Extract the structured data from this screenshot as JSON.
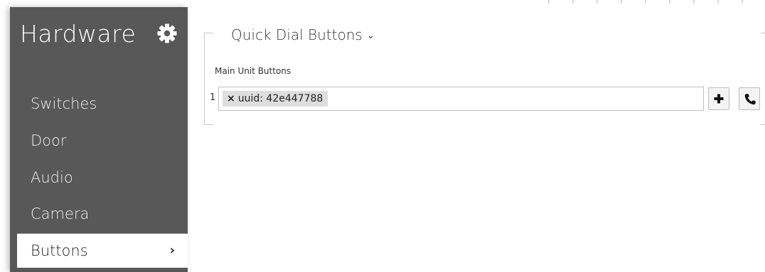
{
  "sidebar": {
    "title": "Hardware",
    "items": [
      {
        "label": "Switches"
      },
      {
        "label": "Door"
      },
      {
        "label": "Audio"
      },
      {
        "label": "Camera"
      },
      {
        "label": "Buttons",
        "chevron": "›"
      }
    ],
    "active_index": 4,
    "background": "#585858"
  },
  "main": {
    "section_title": "Quick Dial Buttons",
    "section_caret": "⌄",
    "field_label": "Main Unit Buttons",
    "rows": [
      {
        "index": "1",
        "tags": [
          {
            "remove": "×",
            "label": "uuid: 42e447788"
          }
        ]
      }
    ],
    "actions": [
      {
        "icon": "plus-icon"
      },
      {
        "icon": "phone-icon"
      }
    ]
  }
}
